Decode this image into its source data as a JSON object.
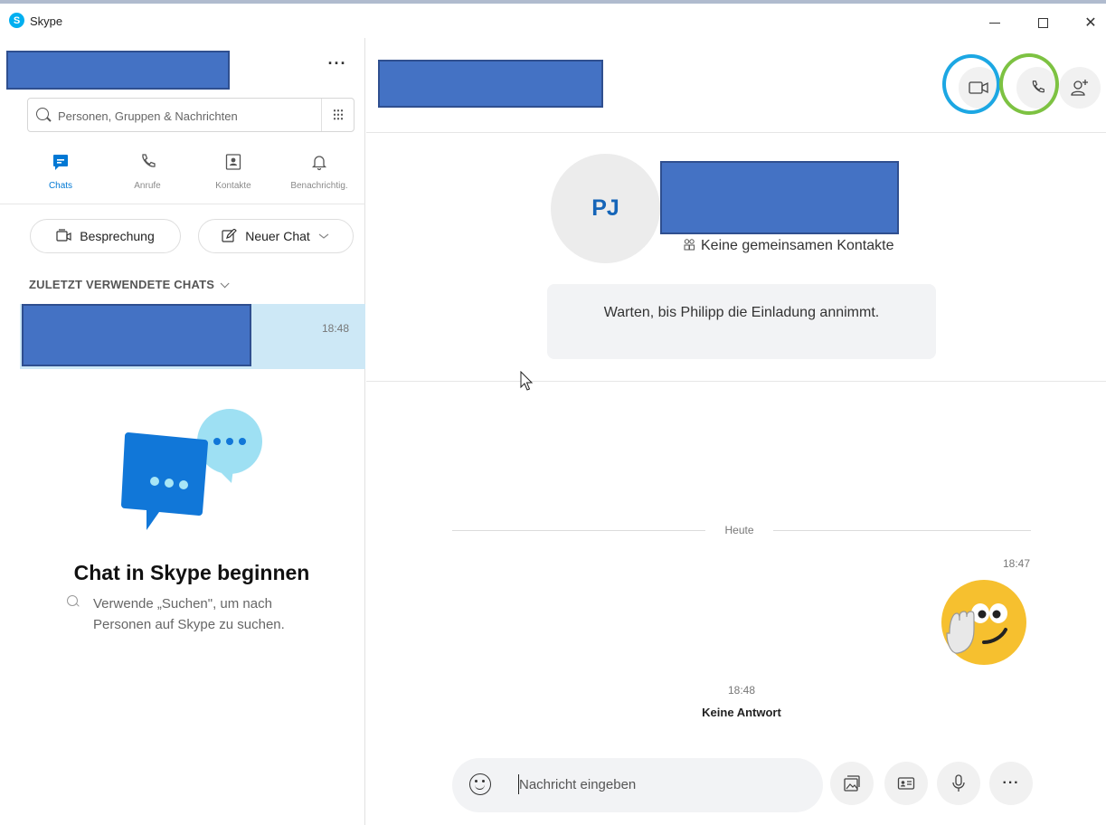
{
  "window": {
    "title": "Skype",
    "logo_letter": "S",
    "close_glyph": "✕"
  },
  "sidebar": {
    "more_label": "···",
    "search": {
      "placeholder": "Personen, Gruppen & Nachrichten"
    },
    "tabs": [
      {
        "label": "Chats",
        "icon": "chat-icon",
        "active": true
      },
      {
        "label": "Anrufe",
        "icon": "phone-icon",
        "active": false
      },
      {
        "label": "Kontakte",
        "icon": "contacts-icon",
        "active": false
      },
      {
        "label": "Benachrichtig.",
        "icon": "bell-icon",
        "active": false
      }
    ],
    "meeting_label": "Besprechung",
    "new_chat_label": "Neuer Chat",
    "recent_header": "ZULETZT VERWENDETE CHATS",
    "recent_chats": [
      {
        "time": "18:48"
      }
    ],
    "empty_state": {
      "title": "Chat in Skype beginnen",
      "hint": "Verwende „Suchen\", um nach Personen auf Skype zu suchen."
    }
  },
  "conversation": {
    "avatar_initials": "PJ",
    "mutual_contacts": "Keine gemeinsamen Kontakte",
    "invite_notice": "Warten, bis Philipp die Einladung annimmt.",
    "day_label": "Heute",
    "message_time": "18:47",
    "missed_call": {
      "time": "18:48",
      "text": "Keine Antwort"
    },
    "composer": {
      "placeholder": "Nachricht eingeben"
    },
    "more_label": "···"
  },
  "colors": {
    "accent": "#0078d4",
    "selected_row": "#cde8f6",
    "highlight_blue_ring": "#1ca7e3",
    "highlight_green_ring": "#7dc242",
    "redaction": "#4472c4"
  }
}
